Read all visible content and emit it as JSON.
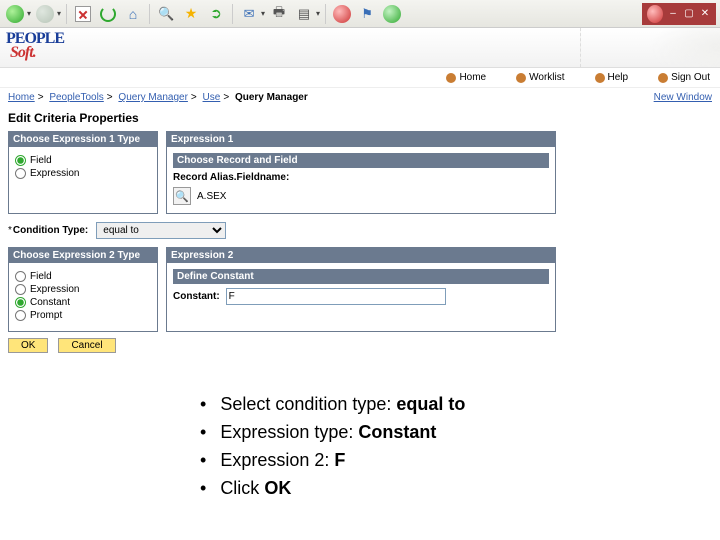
{
  "navbar": {
    "home": "Home",
    "worklist": "Worklist",
    "help": "Help",
    "signout": "Sign Out"
  },
  "breadcrumb": {
    "home": "Home",
    "pt": "PeopleTools",
    "qm": "Query Manager",
    "use": "Use",
    "current": "Query Manager",
    "new_window": "New Window"
  },
  "page_title": "Edit Criteria Properties",
  "exp1type": {
    "head": "Choose Expression 1 Type",
    "field": "Field",
    "expression": "Expression"
  },
  "exp1": {
    "head": "Expression 1",
    "sub": "Choose Record and Field",
    "label": "Record Alias.Fieldname:",
    "value": "A.SEX"
  },
  "condition": {
    "label": "Condition Type:",
    "value": "equal to"
  },
  "exp2type": {
    "head": "Choose Expression 2 Type",
    "field": "Field",
    "expression": "Expression",
    "constant": "Constant",
    "prompt": "Prompt"
  },
  "exp2": {
    "head": "Expression 2",
    "sub": "Define Constant",
    "label": "Constant:",
    "value": "F"
  },
  "buttons": {
    "ok": "OK",
    "cancel": "Cancel"
  },
  "instructions": {
    "i1a": "Select condition type: ",
    "i1b": "equal to",
    "i2a": "Expression type: ",
    "i2b": "Constant",
    "i3a": "Expression 2: ",
    "i3b": "F",
    "i4a": "Click ",
    "i4b": "OK"
  }
}
